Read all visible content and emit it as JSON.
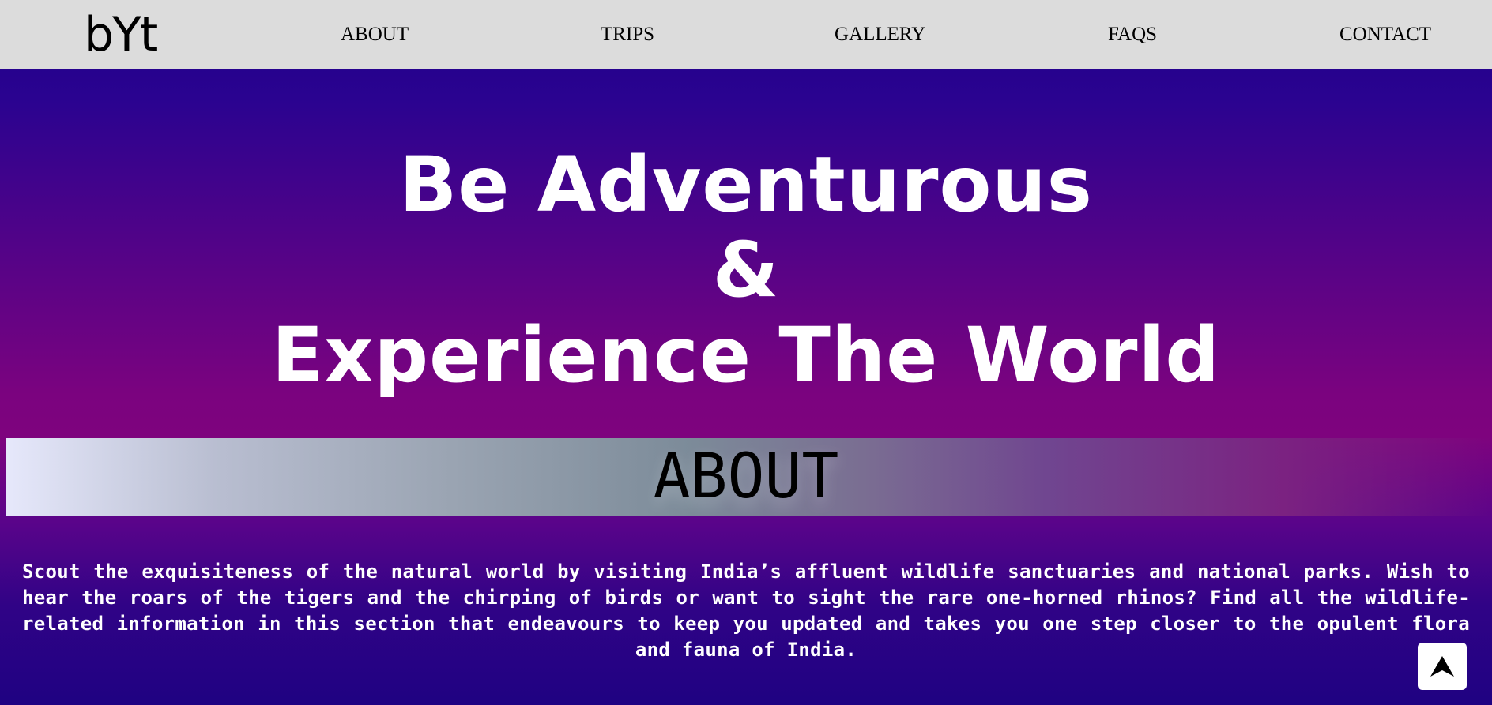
{
  "navbar": {
    "logo": "bYt",
    "links": [
      "ABOUT",
      "TRIPS",
      "GALLERY",
      "FAQS",
      "CONTACT"
    ]
  },
  "hero": {
    "line1": "Be Adventurous",
    "line2": "&",
    "line3": "Experience The World"
  },
  "about": {
    "title": "ABOUT",
    "text": "Scout the exquisiteness of the natural world by visiting India’s affluent wildlife sanctuaries and national parks. Wish to hear the roars of the tigers and the chirping of birds or want to sight the rare one-horned rhinos? Find all the wildlife-related information in this section that endeavours to keep you updated and takes you one step closer to the opulent flora and fauna of India."
  },
  "back_to_top": {
    "icon": "arrow-up-icon"
  },
  "colors": {
    "navbar_bg": "#dcdcdc",
    "gradient_top": "#1e0088",
    "gradient_mid": "#7e037e",
    "gradient_bottom": "#1f0282",
    "text_light": "#ffffff",
    "text_dark": "#000000"
  }
}
